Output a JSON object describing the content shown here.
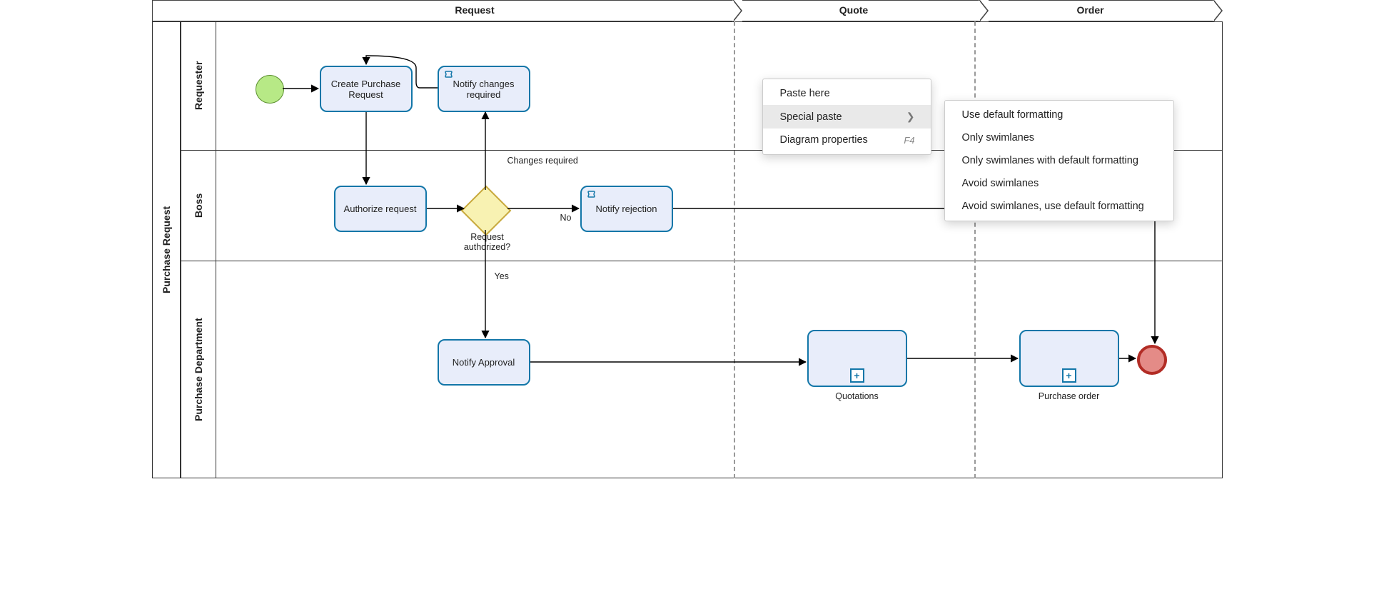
{
  "pool": {
    "title": "Purchase Request"
  },
  "lanes": [
    {
      "id": "requester",
      "label": "Requester"
    },
    {
      "id": "boss",
      "label": "Boss"
    },
    {
      "id": "purchase_dept",
      "label": "Purchase Department"
    }
  ],
  "phases": [
    {
      "id": "request",
      "label": "Request"
    },
    {
      "id": "quote",
      "label": "Quote"
    },
    {
      "id": "order",
      "label": "Order"
    }
  ],
  "tasks": {
    "create_purchase_request": "Create Purchase Request",
    "notify_changes_required": "Notify changes required",
    "authorize_request": "Authorize request",
    "notify_rejection": "Notify rejection",
    "notify_approval": "Notify Approval",
    "quotations": "Quotations",
    "purchase_order": "Purchase order"
  },
  "gateway": {
    "label": "Request authorized?"
  },
  "edge_labels": {
    "changes_required": "Changes required",
    "no": "No",
    "yes": "Yes"
  },
  "context_menu": {
    "items": [
      {
        "id": "paste_here",
        "label": "Paste here"
      },
      {
        "id": "special_paste",
        "label": "Special paste",
        "has_submenu": true,
        "highlighted": true
      },
      {
        "id": "diagram_properties",
        "label": "Diagram properties",
        "shortcut": "F4"
      }
    ]
  },
  "submenu": {
    "items": [
      {
        "id": "use_default_formatting",
        "label": "Use default formatting"
      },
      {
        "id": "only_swimlanes",
        "label": "Only swimlanes"
      },
      {
        "id": "only_swimlanes_default",
        "label": "Only swimlanes with default formatting"
      },
      {
        "id": "avoid_swimlanes",
        "label": "Avoid swimlanes"
      },
      {
        "id": "avoid_swimlanes_default",
        "label": "Avoid swimlanes, use default formatting"
      }
    ]
  },
  "icons": {
    "script": "script-icon",
    "expand": "plus-icon"
  }
}
